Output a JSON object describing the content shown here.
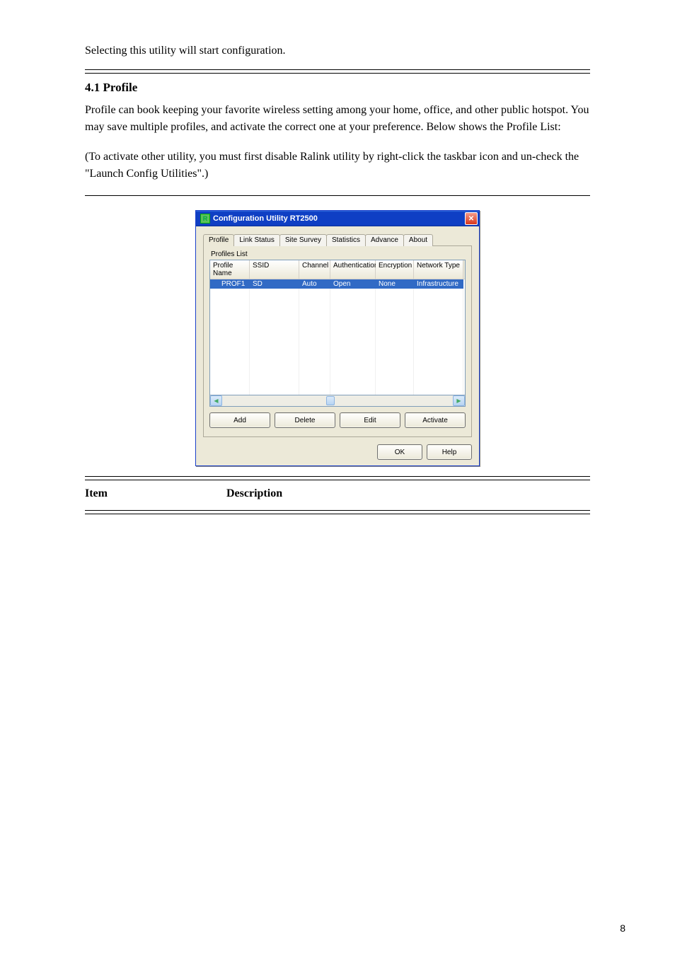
{
  "intro": {
    "p1": "Selecting this utility will start configuration.",
    "hr_sep": true
  },
  "section": {
    "title": "4.1 Profile",
    "p1": "Profile can book keeping your favorite wireless setting among your home, office, and other public hotspot. You may save multiple profiles, and activate the correct one at your preference. Below shows the Profile List:",
    "p2": "(To activate other utility, you must first disable Ralink utility by right-click the taskbar icon and un-check the \"Launch Config Utilities\".)"
  },
  "app": {
    "title": "Configuration Utility RT2500",
    "tabs": [
      "Profile",
      "Link Status",
      "Site Survey",
      "Statistics",
      "Advance",
      "About"
    ],
    "fieldset_label": "Profiles List",
    "columns": [
      "Profile Name",
      "SSID",
      "Channel",
      "Authentication",
      "Encryption",
      "Network Type"
    ],
    "row": {
      "profile_name": "PROF1",
      "ssid": "SD",
      "channel": "Auto",
      "auth": "Open",
      "enc": "None",
      "ntype": "Infrastructure"
    },
    "scroll_glyphs": {
      "left": "◀",
      "right": "▶"
    },
    "buttons": {
      "add": "Add",
      "delete": "Delete",
      "edit": "Edit",
      "activate": "Activate",
      "ok": "OK",
      "help": "Help"
    }
  },
  "item": {
    "label": "Item",
    "desc": "Description"
  },
  "page_number": "8"
}
